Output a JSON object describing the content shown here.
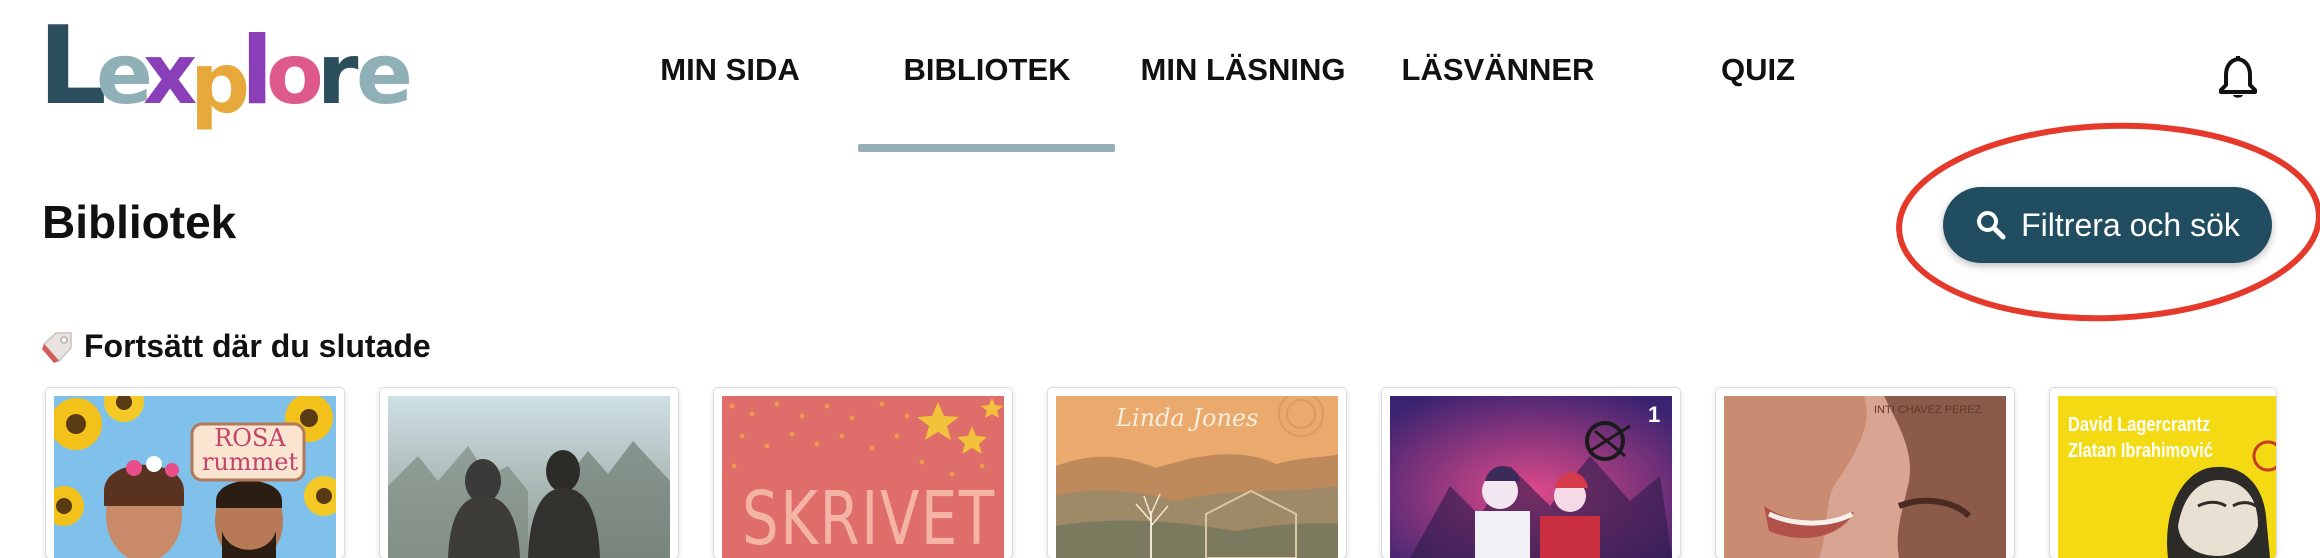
{
  "app": {
    "logo_text": "Lexplore"
  },
  "nav": {
    "items": [
      {
        "label": "MIN SIDA"
      },
      {
        "label": "BIBLIOTEK",
        "active": true
      },
      {
        "label": "MIN LÄSNING"
      },
      {
        "label": "LÄSVÄNNER"
      },
      {
        "label": "QUIZ"
      }
    ]
  },
  "header": {
    "notifications_icon": "bell-icon"
  },
  "page": {
    "title": "Bibliotek"
  },
  "filter": {
    "label": "Filtrera och sök",
    "icon": "search-icon"
  },
  "section": {
    "title": "Fortsätt där du slutade",
    "icon": "tag-icon"
  },
  "books": [
    {
      "cover_text": "ROSA rummet"
    },
    {
      "cover_text": ""
    },
    {
      "cover_text": "SKRIVET I"
    },
    {
      "cover_text": "Linda Jones"
    },
    {
      "cover_text": "1"
    },
    {
      "cover_text": "INTI CHAVEZ PEREZ"
    },
    {
      "cover_text": "David Lagercrantz Zlatan Ibrahimović"
    }
  ],
  "colors": {
    "brand_dark": "#214d61",
    "nav_underline": "#97afb6",
    "annotation_red": "#e53a2b"
  }
}
